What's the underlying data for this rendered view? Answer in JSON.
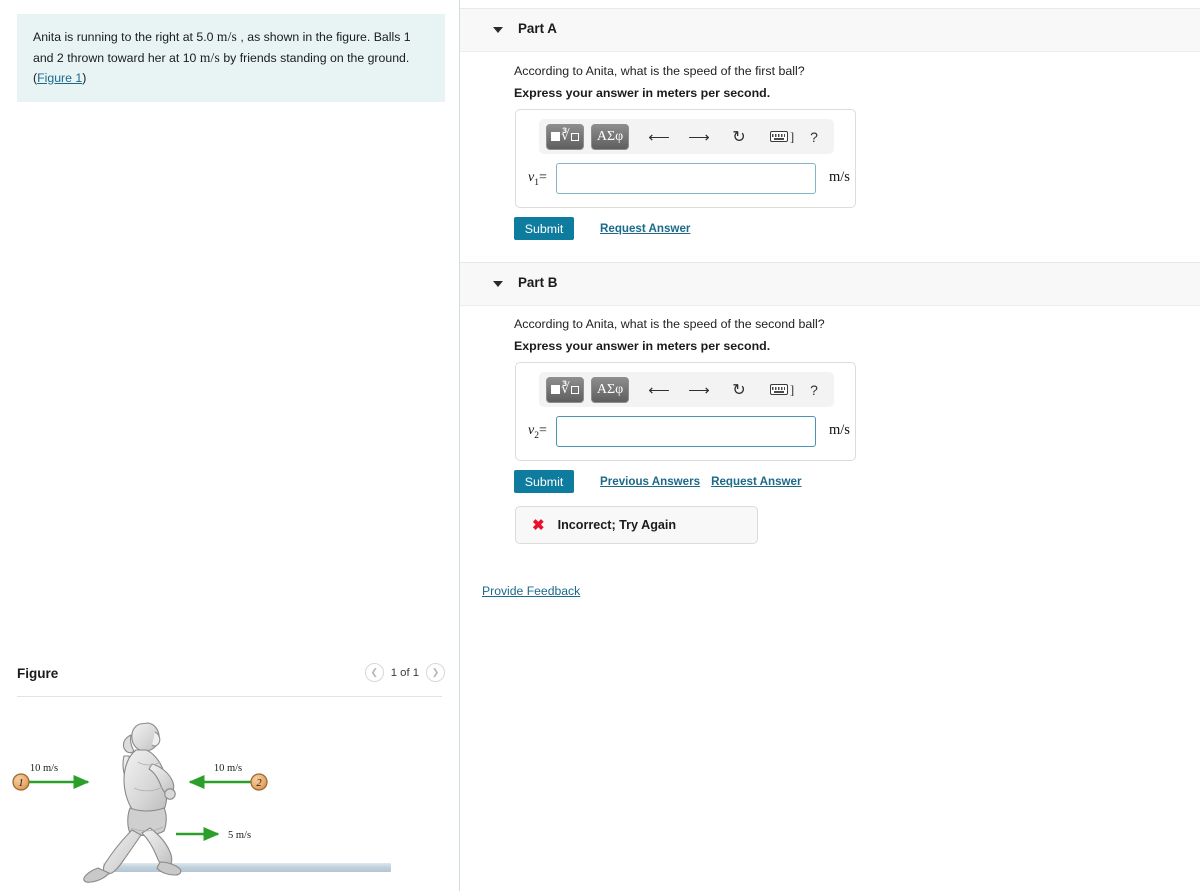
{
  "problem": {
    "text_part1": "Anita is running to the right at 5.0",
    "unit1": "m/s",
    "text_part2": ", as shown in the figure. Balls 1 and 2 thrown toward her at 10",
    "unit2": "m/s",
    "text_part3": "by friends standing on the ground.(",
    "figure_link": "Figure 1",
    "text_part4": ")"
  },
  "figure_panel": {
    "title": "Figure",
    "pager_label": "1 of 1",
    "prev_icon": "chevron-left-icon",
    "next_icon": "chevron-right-icon"
  },
  "figure": {
    "ball1_label": "1",
    "ball1_speed": "10 m/s",
    "ball2_label": "2",
    "ball2_speed": "10 m/s",
    "runner_speed": "5 m/s",
    "ball_fill": "#eba96b",
    "ball_stroke": "#9a6a34",
    "arrow_color": "#2aa02a",
    "ground_color": "#c4d3dd"
  },
  "parts": [
    {
      "title": "Part A",
      "caret_icon": "caret-down-icon",
      "question": "According to Anita, what is the speed of the first ball?",
      "instruction": "Express your answer in meters per second.",
      "var_symbol": "v",
      "var_sub": "1",
      "equals": "=",
      "value": "",
      "unit": "m/s",
      "focused": false,
      "toolbar": {
        "template_btn": "math-template-button",
        "greek_btn": "ΑΣφ",
        "undo_icon": "undo-icon",
        "redo_icon": "redo-icon",
        "reset_icon": "reset-icon",
        "keyboard_icon": "keyboard-icon",
        "keyboard_bracket": "]",
        "help_icon": "?"
      },
      "submit_label": "Submit",
      "links": [
        "Request Answer"
      ],
      "feedback": null
    },
    {
      "title": "Part B",
      "caret_icon": "caret-down-icon",
      "question": "According to Anita, what is the speed of the second ball?",
      "instruction": "Express your answer in meters per second.",
      "var_symbol": "v",
      "var_sub": "2",
      "equals": "=",
      "value": "",
      "unit": "m/s",
      "focused": true,
      "toolbar": {
        "template_btn": "math-template-button",
        "greek_btn": "ΑΣφ",
        "undo_icon": "undo-icon",
        "redo_icon": "redo-icon",
        "reset_icon": "reset-icon",
        "keyboard_icon": "keyboard-icon",
        "keyboard_bracket": "]",
        "help_icon": "?"
      },
      "submit_label": "Submit",
      "links": [
        "Previous Answers",
        "Request Answer"
      ],
      "feedback": {
        "icon": "cross-icon",
        "text": "Incorrect; Try Again",
        "color": "#e8112d"
      }
    }
  ],
  "footer": {
    "provide_feedback": "Provide Feedback"
  },
  "colors": {
    "accent": "#0e7c9e",
    "link": "#1b6a8a",
    "problem_bg": "#e8f4f4",
    "band_bg": "#f8f8f8",
    "input_border": "#7fb4c9",
    "error": "#e8112d"
  }
}
